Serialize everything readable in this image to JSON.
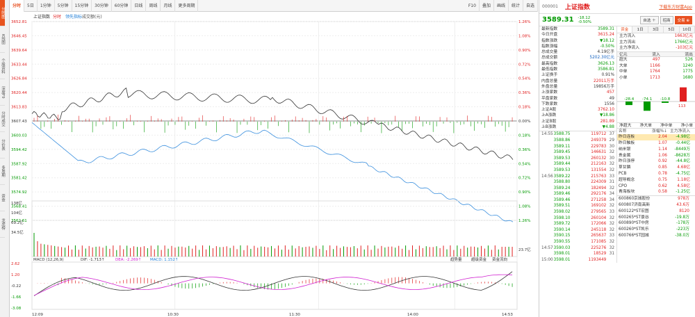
{
  "toolbar": {
    "tabs": [
      "分时",
      "5日",
      "1分钟",
      "5分钟",
      "15分钟",
      "30分钟",
      "60分钟",
      "日线",
      "周线",
      "月线",
      "更多周期"
    ],
    "right": [
      "F10",
      "叠加",
      "画线",
      "统计",
      "自选"
    ]
  },
  "sidebar": [
    "分时图",
    "K线图",
    "个股资料",
    "深度F9",
    "分时成交",
    "分价表",
    "多周期",
    "资金",
    "龙虎榜"
  ],
  "chart": {
    "legend": {
      "index": "上证指数",
      "tab": "分时",
      "lead": "领先指标",
      "vol": "成交额(元)"
    },
    "y_labels": [
      "3652.81",
      "3646.45",
      "3639.64",
      "3633.44",
      "3626.84",
      "3620.44",
      "3613.83",
      "3607.43",
      "3600.03",
      "3594.42",
      "3587.92",
      "3581.42",
      "3574.92",
      "3568.41",
      "3562.61"
    ],
    "y_pct": [
      "1.26%",
      "1.08%",
      "0.90%",
      "0.72%",
      "0.54%",
      "0.36%",
      "0.18%",
      "0.00%",
      "0.18%",
      "0.36%",
      "0.54%",
      "0.72%",
      "0.90%",
      "1.08%",
      "1.26%"
    ],
    "time_labels": [
      "12:09",
      "10:30",
      "11:30",
      "14:00",
      "14:53"
    ],
    "vol_labels": [
      "138亿",
      "104亿",
      "69.2亿",
      "34.5亿"
    ],
    "vol_right": "23.7亿",
    "macd_title": "MACD (12,26,9)",
    "dif": "DIF: -1.713↑",
    "dea": "DEA: -2.269↑",
    "macd": "MACD: 1.152↑",
    "macd_labels": [
      "2.62",
      "1.20",
      "-0.22",
      "-1.66",
      "-3.08"
    ],
    "indicator_tabs": [
      "趋势量",
      "超级资金",
      "资金流向"
    ]
  },
  "right": {
    "code": "000001",
    "name": "上证指数",
    "link": "下载东方财富App",
    "price": "3589.31",
    "change": "-18.12",
    "pct": "-0.50%",
    "btns": [
      "自选 ＋",
      "招商",
      "交易 ⊕"
    ],
    "stats": [
      [
        "最新指数",
        "3589.31"
      ],
      [
        "今日开盘",
        "3615.24"
      ],
      [
        "指数涨跌",
        "▼18.12"
      ],
      [
        "指数涨幅",
        "-0.50%"
      ],
      [
        "总成交量",
        "4.19亿手"
      ],
      [
        "总成交额",
        "5202.30亿元"
      ],
      [
        "最高指数",
        "3626.13"
      ],
      [
        "最低指数",
        "3586.81"
      ],
      [
        "上证换手",
        "0.91%"
      ],
      [
        "内盘总量",
        "22011万手"
      ],
      [
        "外盘总量",
        "19856万手"
      ],
      [
        "上涨家数",
        "457"
      ],
      [
        "平盘家数",
        "49"
      ],
      [
        "下跌家数",
        "1556"
      ],
      [
        "上证A股",
        "3762.10"
      ],
      [
        "上A涨跌",
        "▼18.86"
      ],
      [
        "上证B股",
        "281.89"
      ],
      [
        "上B涨跌",
        "▼4.88"
      ]
    ],
    "fund_tabs": [
      "资金",
      "1日",
      "3日",
      "5日",
      "10日"
    ],
    "fund_in": [
      [
        "主力流入",
        "1663亿元"
      ],
      [
        "主力流出",
        "1766亿元"
      ],
      [
        "主力净流入",
        "-103亿元"
      ]
    ],
    "flow_head": [
      "亿元",
      "流入",
      "流出"
    ],
    "flow": [
      [
        "超大",
        "497",
        "526"
      ],
      [
        "大单",
        "1166",
        "1240"
      ],
      [
        "中单",
        "1764",
        "1775"
      ],
      [
        "小单",
        "1713",
        "1680"
      ]
    ],
    "bar_vals": [
      "-28.4",
      "-74.1",
      "-10.8",
      "113"
    ],
    "bar_labels": [
      "净超大",
      "净大单",
      "净中单",
      "净小单"
    ],
    "ticks": [
      [
        "14:55",
        "3588.75",
        "119712",
        "37"
      ],
      [
        "",
        "3588.86",
        "249379",
        "29"
      ],
      [
        "",
        "3589.11",
        "229783",
        "30"
      ],
      [
        "",
        "3589.45",
        "146631",
        "32"
      ],
      [
        "",
        "3589.53",
        "260132",
        "30"
      ],
      [
        "",
        "3589.44",
        "212163",
        "32"
      ],
      [
        "",
        "3589.53",
        "131554",
        "32"
      ],
      [
        "14:56",
        "3589.22",
        "215763",
        "33"
      ],
      [
        "",
        "3588.80",
        "224309",
        "31"
      ],
      [
        "",
        "3589.24",
        "182494",
        "32"
      ],
      [
        "",
        "3589.46",
        "292176",
        "34"
      ],
      [
        "",
        "3589.46",
        "271258",
        "34"
      ],
      [
        "",
        "3589.51",
        "169102",
        "32"
      ],
      [
        "",
        "3598.02",
        "279565",
        "33"
      ],
      [
        "",
        "3598.10",
        "260104",
        "32"
      ],
      [
        "",
        "3589.72",
        "172066",
        "32"
      ],
      [
        "",
        "3590.14",
        "245118",
        "32"
      ],
      [
        "",
        "3590.15",
        "265637",
        "33"
      ],
      [
        "",
        "3590.55",
        "171085",
        "32"
      ],
      [
        "14:57",
        "3590.03",
        "225276",
        "32"
      ],
      [
        "",
        "3598.01",
        "18529",
        "31"
      ],
      [
        "15:00",
        "3598.01",
        "1193449",
        ""
      ]
    ],
    "sector_head": [
      "名称",
      "涨幅%↓",
      "主力净流入"
    ],
    "sectors": [
      [
        "昨日连板",
        "2.04",
        "-4.98亿"
      ],
      [
        "昨日触板",
        "1.07",
        "-0.44亿"
      ],
      [
        "纳米银",
        "1.14",
        "-8449万"
      ],
      [
        "贵金属",
        "1.06",
        "-8628万"
      ],
      [
        "昨日涨停",
        "0.92",
        "-44.8亿"
      ],
      [
        "草甘膦",
        "0.85",
        "4.68亿"
      ],
      [
        "PCB",
        "0.78",
        "-4.75亿"
      ],
      [
        "超导概念",
        "0.75",
        "1.18亿"
      ],
      [
        "CPO",
        "0.62",
        "4.58亿"
      ],
      [
        "青海板块",
        "0.58",
        "-1.25亿"
      ]
    ],
    "stocks": [
      [
        "600860",
        "京城股份",
        "978万"
      ],
      [
        "600807",
        "济南高新",
        "43.6万"
      ],
      [
        "600122",
        "*ST宏图",
        "8120"
      ],
      [
        "600265",
        "*ST景谷",
        "-19.8万"
      ],
      [
        "600890",
        "*ST中房",
        "-178万"
      ],
      [
        "600260",
        "*ST凯乐",
        "-223万"
      ],
      [
        "600766",
        "*ST园城",
        "-38.0万"
      ]
    ]
  }
}
